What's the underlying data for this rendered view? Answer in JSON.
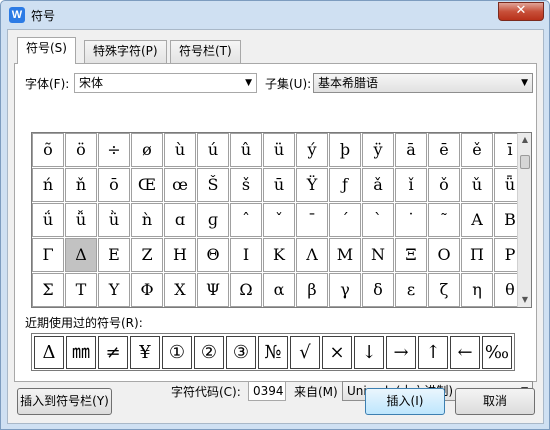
{
  "window": {
    "title": "符号",
    "app_icon_letter": "W",
    "close": "✕"
  },
  "tabs": [
    {
      "label": "符号(S)",
      "active": true
    },
    {
      "label": "特殊字符(P)",
      "active": false
    },
    {
      "label": "符号栏(T)",
      "active": false
    }
  ],
  "font": {
    "label": "字体(F):",
    "value": "宋体"
  },
  "subset": {
    "label": "子集(U):",
    "value": "基本希腊语"
  },
  "symbol_rows": [
    [
      "õ",
      "ö",
      "÷",
      "ø",
      "ù",
      "ú",
      "û",
      "ü",
      "ý",
      "þ",
      "ÿ",
      "ā",
      "ē",
      "ě",
      "ī"
    ],
    [
      "ń",
      "ň",
      "ō",
      "Œ",
      "œ",
      "Š",
      "š",
      "ū",
      "Ÿ",
      "ƒ",
      "ǎ",
      "ǐ",
      "ǒ",
      "ǔ",
      "ǖ"
    ],
    [
      "ǘ",
      "ǚ",
      "ǜ",
      "ǹ",
      "ɑ",
      "ɡ",
      "ˆ",
      "ˇ",
      "ˉ",
      "ˊ",
      "ˋ",
      "˙",
      "˜",
      "Α",
      "Β"
    ],
    [
      "Γ",
      "Δ",
      "Ε",
      "Ζ",
      "Η",
      "Θ",
      "Ι",
      "Κ",
      "Λ",
      "Μ",
      "Ν",
      "Ξ",
      "Ο",
      "Π",
      "Ρ"
    ],
    [
      "Σ",
      "Τ",
      "Υ",
      "Φ",
      "Χ",
      "Ψ",
      "Ω",
      "α",
      "β",
      "γ",
      "δ",
      "ε",
      "ζ",
      "η",
      "θ"
    ]
  ],
  "selected_symbol": "Δ",
  "recent": {
    "label": "近期使用过的符号(R):",
    "items": [
      "Δ",
      "㎜",
      "≠",
      "¥",
      "①",
      "②",
      "③",
      "№",
      "√",
      "×",
      "↓",
      "→",
      "↑",
      "←",
      "‰"
    ]
  },
  "char_code": {
    "label": "字符代码(C):",
    "value": "0394"
  },
  "from": {
    "label": "来自(M)",
    "value": "Unicode(十六进制)"
  },
  "buttons": {
    "insert_to_bar": "插入到符号栏(Y)",
    "insert": "插入(I)",
    "cancel": "取消"
  }
}
